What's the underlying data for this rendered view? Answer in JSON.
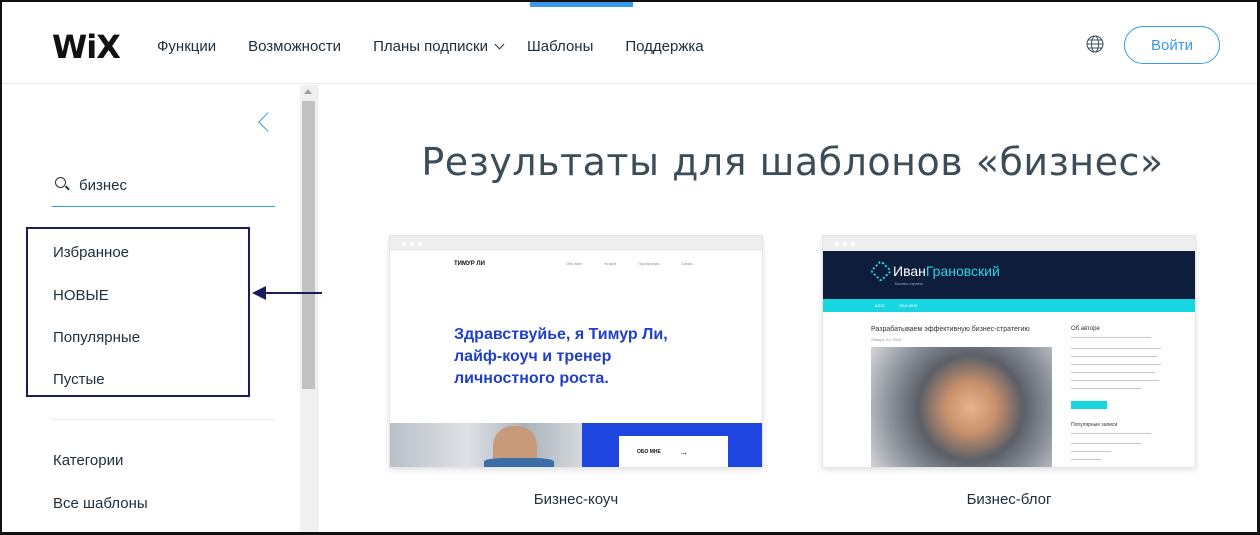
{
  "header": {
    "logo": "WiX",
    "nav": [
      {
        "label": "Функции",
        "dropdown": false
      },
      {
        "label": "Возможности",
        "dropdown": false
      },
      {
        "label": "Планы подписки",
        "dropdown": true
      },
      {
        "label": "Шаблоны",
        "dropdown": false,
        "active": true
      },
      {
        "label": "Поддержка",
        "dropdown": false
      }
    ],
    "globe_icon": "globe-icon",
    "login_label": "Войти",
    "accent_color": "#3899ec"
  },
  "sidebar": {
    "search_value": "бизнес",
    "filters": [
      "Избранное",
      "НОВЫЕ",
      "Популярные",
      "Пустые"
    ],
    "categories_label": "Категории",
    "all_templates_label": "Все шаблоны"
  },
  "main": {
    "title": "Результаты для шаблонов «бизнес»",
    "cards": [
      {
        "label": "Бизнес-коуч",
        "preview": {
          "name": "ТИМУР ЛИ",
          "nav": [
            "Обо мне",
            "Услуги",
            "Портфолио",
            "Связь"
          ],
          "heading": "Здравствуйье, я Тимур Ли, лайф-коуч и тренер личностного роста.",
          "about_button": "ОБО МНЕ",
          "accent_color": "#1f45e0"
        }
      },
      {
        "label": "Бизнес-блог",
        "preview": {
          "title_part1": "Иван",
          "title_part2": "Грановский",
          "subtitle": "Бизнес-стратег",
          "nav": [
            "БЛОГ",
            "ОБО МНЕ"
          ],
          "post_title": "Разрабатываем эффективную бизнес-стратегию",
          "post_date": "Январь 21, 2014",
          "about_heading": "Об авторе",
          "recent_heading": "Популярные записи",
          "accent_color": "#18d6e0"
        }
      }
    ]
  }
}
